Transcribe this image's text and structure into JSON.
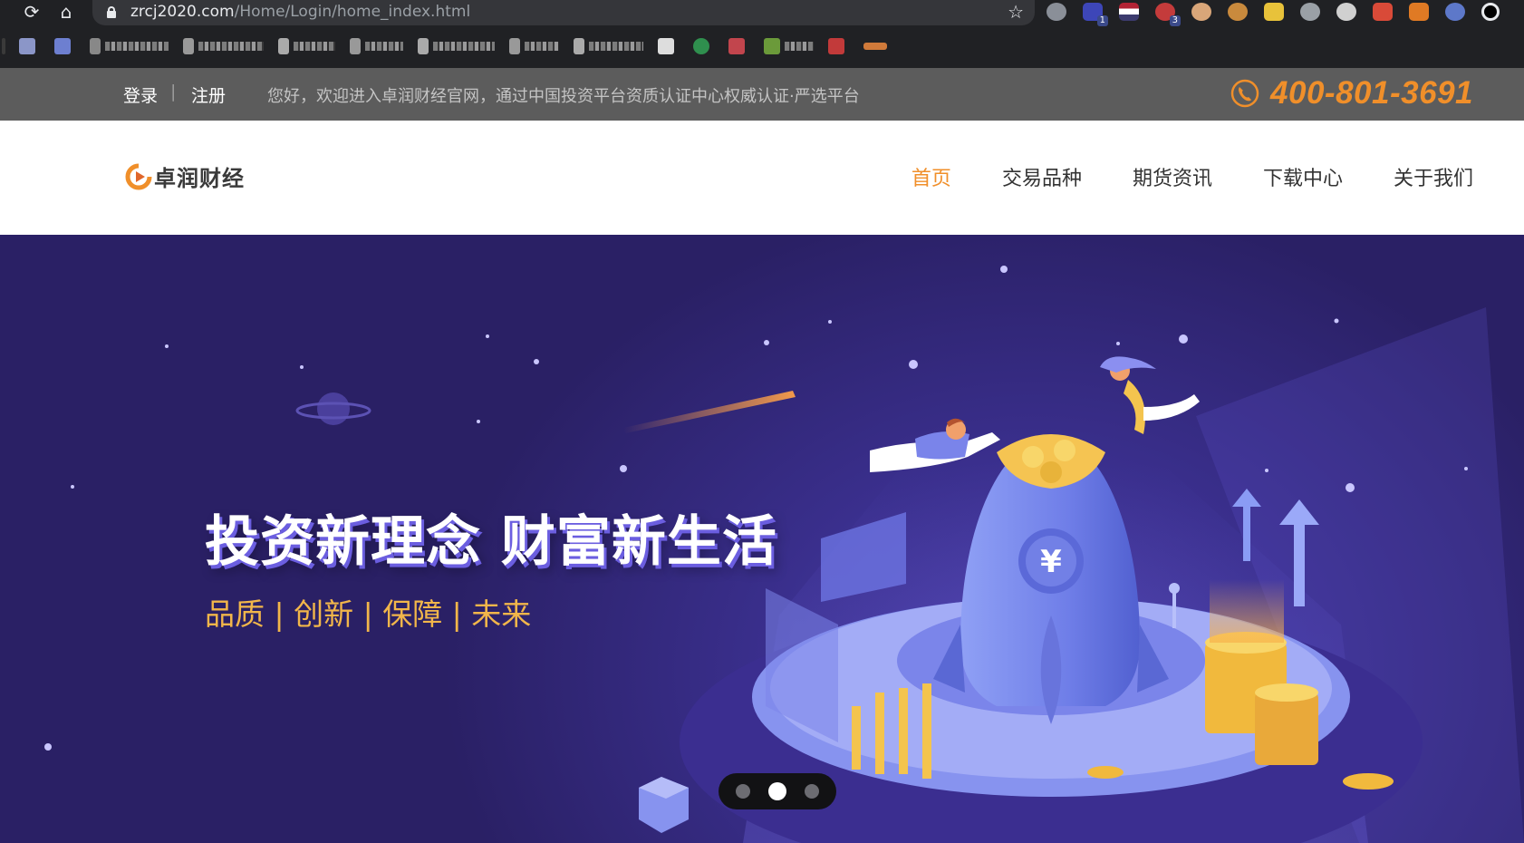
{
  "browser": {
    "url_host": "zrcj2020.com",
    "url_path": "/Home/Login/home_index.html",
    "extension_badges": [
      "1",
      "3"
    ]
  },
  "topbar": {
    "login": "登录",
    "register": "注册",
    "separator": "|",
    "welcome": "您好，欢迎进入卓润财经官网，通过中国投资平台资质认证中心权威认证·严选平台",
    "hotline": "400-801-3691"
  },
  "header": {
    "logo_text": "卓润财经",
    "nav": [
      {
        "label": "首页",
        "active": true
      },
      {
        "label": "交易品种",
        "active": false
      },
      {
        "label": "期货资讯",
        "active": false
      },
      {
        "label": "下载中心",
        "active": false
      },
      {
        "label": "关于我们",
        "active": false
      }
    ]
  },
  "banner": {
    "title": "投资新理念 财富新生活",
    "tagline": "品质 |  创新 | 保障 | 未来",
    "slides": 3,
    "active_slide": 2
  },
  "colors": {
    "accent": "#f08f2a",
    "topbar_bg": "#5c5c5c",
    "banner_bg": "#2a2065",
    "tagline": "#f2b64a"
  }
}
